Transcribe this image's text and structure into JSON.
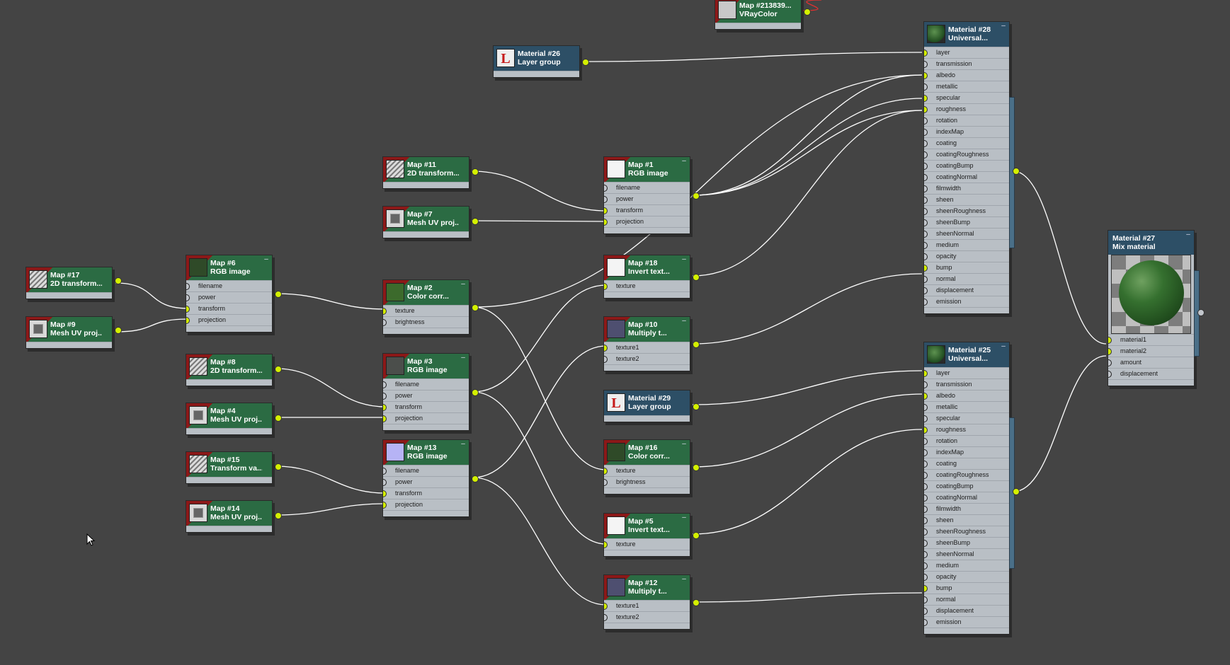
{
  "nodes": {
    "map17": {
      "title1": "Map #17",
      "title2": "2D transform..."
    },
    "map9": {
      "title1": "Map #9",
      "title2": "Mesh UV proj..."
    },
    "map6": {
      "title1": "Map #6",
      "title2": "RGB image",
      "ports": [
        "filename",
        "power",
        "transform",
        "projection"
      ]
    },
    "map8": {
      "title1": "Map #8",
      "title2": "2D transform..."
    },
    "map4": {
      "title1": "Map #4",
      "title2": "Mesh UV proj..."
    },
    "map15": {
      "title1": "Map #15",
      "title2": "Transform va..."
    },
    "map14": {
      "title1": "Map #14",
      "title2": "Mesh UV proj..."
    },
    "map11": {
      "title1": "Map #11",
      "title2": "2D transform..."
    },
    "map7": {
      "title1": "Map #7",
      "title2": "Mesh UV proj..."
    },
    "map2": {
      "title1": "Map #2",
      "title2": "Color corr...",
      "ports": [
        "texture",
        "brightness"
      ]
    },
    "map3": {
      "title1": "Map #3",
      "title2": "RGB image",
      "ports": [
        "filename",
        "power",
        "transform",
        "projection"
      ]
    },
    "map13": {
      "title1": "Map #13",
      "title2": "RGB image",
      "ports": [
        "filename",
        "power",
        "transform",
        "projection"
      ]
    },
    "mat26": {
      "title1": "Material #26",
      "title2": "Layer group"
    },
    "map213": {
      "title1": "Map #213839...",
      "title2": "VRayColor"
    },
    "map1": {
      "title1": "Map #1",
      "title2": "RGB image",
      "ports": [
        "filename",
        "power",
        "transform",
        "projection"
      ]
    },
    "map18": {
      "title1": "Map #18",
      "title2": "Invert text...",
      "ports": [
        "texture"
      ]
    },
    "map10": {
      "title1": "Map #10",
      "title2": "Multiply t...",
      "ports": [
        "texture1",
        "texture2"
      ]
    },
    "mat29": {
      "title1": "Material #29",
      "title2": "Layer group"
    },
    "map16": {
      "title1": "Map #16",
      "title2": "Color corr...",
      "ports": [
        "texture",
        "brightness"
      ]
    },
    "map5": {
      "title1": "Map #5",
      "title2": "Invert text...",
      "ports": [
        "texture"
      ]
    },
    "map12": {
      "title1": "Map #12",
      "title2": "Multiply t...",
      "ports": [
        "texture1",
        "texture2"
      ]
    },
    "mat28": {
      "title1": "Material #28",
      "title2": "Universal...",
      "ports": [
        "layer",
        "transmission",
        "albedo",
        "metallic",
        "specular",
        "roughness",
        "rotation",
        "indexMap",
        "coating",
        "coatingRoughness",
        "coatingBump",
        "coatingNormal",
        "filmwidth",
        "sheen",
        "sheenRoughness",
        "sheenBump",
        "sheenNormal",
        "medium",
        "opacity",
        "bump",
        "normal",
        "displacement",
        "emission"
      ]
    },
    "mat25": {
      "title1": "Material #25",
      "title2": "Universal...",
      "ports": [
        "layer",
        "transmission",
        "albedo",
        "metallic",
        "specular",
        "roughness",
        "rotation",
        "indexMap",
        "coating",
        "coatingRoughness",
        "coatingBump",
        "coatingNormal",
        "filmwidth",
        "sheen",
        "sheenRoughness",
        "sheenBump",
        "sheenNormal",
        "medium",
        "opacity",
        "bump",
        "normal",
        "displacement",
        "emission"
      ]
    },
    "mat27": {
      "title1": "Material #27",
      "title2": "Mix material",
      "ports": [
        "material1",
        "material2",
        "amount",
        "displacement"
      ]
    }
  },
  "colors": {
    "background": "#444444",
    "wire": "#ffffff",
    "socket_active": "#d4f000",
    "map_header": "#2b6b43",
    "material_header": "#2d4f66"
  }
}
